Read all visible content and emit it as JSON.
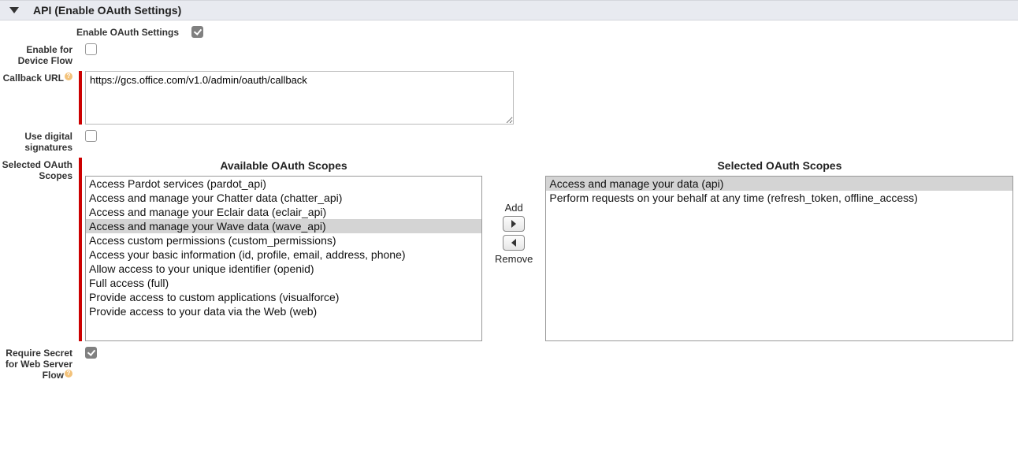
{
  "section": {
    "title": "API (Enable OAuth Settings)"
  },
  "fields": {
    "enable_oauth": {
      "label": "Enable OAuth Settings",
      "checked": true
    },
    "device_flow": {
      "label": "Enable for Device Flow",
      "checked": false
    },
    "callback": {
      "label": "Callback URL",
      "value": "https://gcs.office.com/v1.0/admin/oauth/callback"
    },
    "digital_sig": {
      "label": "Use digital signatures",
      "checked": false
    },
    "scopes_label": "Selected OAuth Scopes",
    "require_secret": {
      "label": "Require Secret for Web Server Flow",
      "checked": true
    }
  },
  "picklist": {
    "available_title": "Available OAuth Scopes",
    "selected_title": "Selected OAuth Scopes",
    "add_label": "Add",
    "remove_label": "Remove",
    "available": [
      "Access Pardot services (pardot_api)",
      "Access and manage your Chatter data (chatter_api)",
      "Access and manage your Eclair data (eclair_api)",
      "Access and manage your Wave data (wave_api)",
      "Access custom permissions (custom_permissions)",
      "Access your basic information (id, profile, email, address, phone)",
      "Allow access to your unique identifier (openid)",
      "Full access (full)",
      "Provide access to custom applications (visualforce)",
      "Provide access to your data via the Web (web)"
    ],
    "available_selected_index": 3,
    "selected": [
      "Access and manage your data (api)",
      "Perform requests on your behalf at any time (refresh_token, offline_access)"
    ],
    "selected_selected_index": 0
  }
}
